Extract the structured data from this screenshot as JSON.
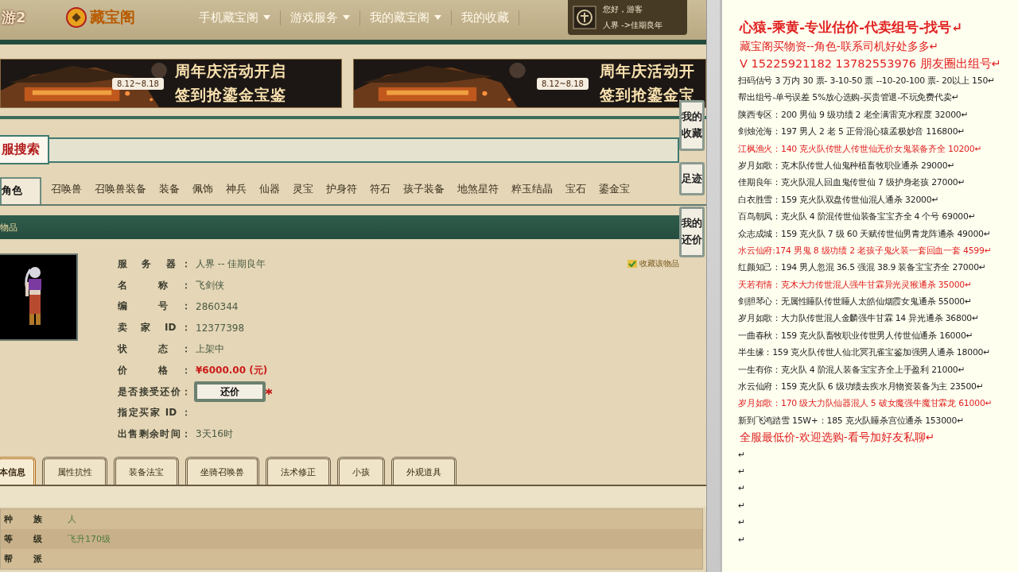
{
  "header": {
    "game_logo": "游2",
    "site_logo": "藏宝阁",
    "nav": [
      {
        "label": "手机藏宝阁",
        "dropdown": true
      },
      {
        "label": "游戏服务",
        "dropdown": true
      },
      {
        "label": "我的藏宝阁",
        "dropdown": true
      },
      {
        "label": "我的收藏",
        "dropdown": false
      }
    ],
    "user": {
      "greeting": "您好，游客",
      "server": "人界 ->佳期良年"
    }
  },
  "banners": [
    {
      "date": "8.12~8.18",
      "line_1": "周年庆活动开启",
      "line_2": "签到抢鎏金宝鉴"
    },
    {
      "date": "8.12~8.18",
      "line_1": "周年庆活动开",
      "line_2": "签到抢鎏金宝"
    }
  ],
  "search": {
    "label": "服搜索"
  },
  "categories": [
    {
      "label": "角色",
      "selected": true
    },
    {
      "label": "召唤兽",
      "selected": false
    },
    {
      "label": "召唤兽装备",
      "selected": false
    },
    {
      "label": "装备",
      "selected": false
    },
    {
      "label": "佩饰",
      "selected": false
    },
    {
      "label": "神兵",
      "selected": false
    },
    {
      "label": "仙器",
      "selected": false
    },
    {
      "label": "灵宝",
      "selected": false
    },
    {
      "label": "护身符",
      "selected": false
    },
    {
      "label": "符石",
      "selected": false
    },
    {
      "label": "孩子装备",
      "selected": false
    },
    {
      "label": "地煞星符",
      "selected": false
    },
    {
      "label": "粹玉结晶",
      "selected": false
    },
    {
      "label": "宝石",
      "selected": false
    },
    {
      "label": "鎏金宝",
      "selected": false
    }
  ],
  "section_title": "物品",
  "side_tabs": [
    "我的收藏",
    "足迹",
    "我的还价"
  ],
  "item": {
    "kind": "picture",
    "favorite_link": "收藏该物品",
    "fields": [
      {
        "label": "服 务 器：",
        "value": "人界 -- 佳期良年",
        "kind": "text"
      },
      {
        "label": "名 称：",
        "value": "飞剑侠",
        "kind": "text"
      },
      {
        "label": "编 号：",
        "value": "2860344",
        "kind": "text"
      },
      {
        "label": "卖 家 ID：",
        "value": "12377398",
        "kind": "text"
      },
      {
        "label": "状 态：",
        "value": "上架中",
        "kind": "text"
      },
      {
        "label": "价 格：",
        "value": "¥6000.00 (元)",
        "kind": "price"
      },
      {
        "label": "是否接受还价：",
        "value": "还价",
        "kind": "button"
      },
      {
        "label": "指定买家 ID ：",
        "kind": "text"
      },
      {
        "label": "出售剩余时间：",
        "value": "3天16时",
        "kind": "text"
      }
    ]
  },
  "detail_tabs": [
    {
      "label": "本信息",
      "selected": true
    },
    {
      "label": "属性抗性",
      "selected": false
    },
    {
      "label": "装备法宝",
      "selected": false
    },
    {
      "label": "坐骑召唤兽",
      "selected": false
    },
    {
      "label": "法术修正",
      "selected": false
    },
    {
      "label": "小孩",
      "selected": false
    },
    {
      "label": "外观道具",
      "selected": false
    }
  ],
  "attributes": [
    {
      "label": "种 族",
      "value": "人"
    },
    {
      "label": "等 级",
      "value": "飞升170级"
    },
    {
      "label": "帮 派"
    }
  ],
  "notes": [
    {
      "kind": "title",
      "color": "#e02020",
      "text": "心猿-乘黄-专业估价-代卖组号-找号↵"
    },
    {
      "kind": "contact",
      "color": "#e02020",
      "text": "藏宝阁买物资--角色-联系司机好处多多↵"
    },
    {
      "kind": "phone",
      "color": "#e02020",
      "text": "V 15225921182   13782553976 朋友圈出组号↵"
    },
    {
      "kind": "line",
      "color": "#222222",
      "text": "扫码估号 3 万内 30 票- 3-10-50 票  --10-20-100 票- 20以上 150↵"
    },
    {
      "kind": "line",
      "color": "#222222",
      "text": "帮出组号-单号误差 5%放心选购-买贵管退-不玩免费代卖↵"
    },
    {
      "kind": "line",
      "color": "#222222",
      "text": "陕西专区：200 男仙 9 级功绩 2 老全满雷克水程度 32000↵"
    },
    {
      "kind": "line",
      "color": "#222222",
      "text": "剑烛沧海：197 男人 2 老 5 正骨混心猿孟极妙音 116800↵"
    },
    {
      "kind": "line",
      "color": "#e02020",
      "text": "江枫渔火：140 克火队传世人传世仙无价女鬼装备齐全 10200↵"
    },
    {
      "kind": "line",
      "color": "#222222",
      "text": "岁月如歌：克木队传世人仙鬼种植畜牧职业通杀 29000↵"
    },
    {
      "kind": "line",
      "color": "#222222",
      "text": "佳期良年：克火队混人回血鬼传世仙 7 级护身老孩 27000↵"
    },
    {
      "kind": "line",
      "color": "#222222",
      "text": "白衣胜雪：159 克火队双盘传世仙混人通杀 32000↵"
    },
    {
      "kind": "line",
      "color": "#222222",
      "text": "百鸟朝凤：克火队 4 阶混传世仙装备宝宝齐全 4 个号 69000↵"
    },
    {
      "kind": "line",
      "color": "#222222",
      "text": "众志成城：159 克火队 7 级 60 天赋传世仙男青龙阵通杀 49000↵"
    },
    {
      "kind": "line",
      "color": "#e02020",
      "text": "水云仙府:174 男鬼 8 级功绩 2 老孩子鬼火装一套回血一套 4599↵"
    },
    {
      "kind": "line",
      "color": "#222222",
      "text": "红颜知己：194 男人忽混 36.5 强混 38.9 装备宝宝齐全 27000↵"
    },
    {
      "kind": "line",
      "color": "#e02020",
      "text": "天若有情：克木大力传世混人强牛甘霖异光灵猴通杀 35000↵"
    },
    {
      "kind": "line",
      "color": "#222222",
      "text": "剑胆琴心：无属性睡队传世睡人太皓仙烟霞女鬼通杀 55000↵"
    },
    {
      "kind": "line",
      "color": "#222222",
      "text": "岁月如歌：大力队传世混人金麟强牛甘霖 14 异光通杀 36800↵"
    },
    {
      "kind": "line",
      "color": "#222222",
      "text": "一曲春秋：159 克火队畜牧职业传世男人传世仙通杀 16000↵"
    },
    {
      "kind": "line",
      "color": "#222222",
      "text": "半生缘：159 克火队传世人仙北冥孔雀宝鉴加强男人通杀 18000↵"
    },
    {
      "kind": "line",
      "color": "#222222",
      "text": "一生有你：克火队 4 阶混人装备宝宝齐全上手盈利 21000↵"
    },
    {
      "kind": "line",
      "color": "#222222",
      "text": "水云仙府：159 克火队 6 级功绩去疾水月物资装备为主 23500↵"
    },
    {
      "kind": "line",
      "color": "#e02020",
      "text": "岁月如歌：170 级大力队仙器混人 5 破女魔强牛魔甘霖龙 61000↵"
    },
    {
      "kind": "line",
      "color": "#222222",
      "text": "新到飞鸿踏雪 15W+：185 克火队睡杀宫位通杀 153000↵"
    },
    {
      "kind": "contact",
      "color": "#e02020",
      "text": "全服最低价-欢迎选购-看号加好友私聊↵"
    },
    {
      "kind": "line",
      "color": "#222222",
      "text": "↵"
    },
    {
      "kind": "line",
      "color": "#222222",
      "text": "↵"
    },
    {
      "kind": "line",
      "color": "#222222",
      "text": "↵"
    },
    {
      "kind": "line",
      "color": "#222222",
      "text": "↵"
    },
    {
      "kind": "line",
      "color": "#222222",
      "text": "↵"
    },
    {
      "kind": "line",
      "color": "#222222",
      "text": "↵"
    }
  ]
}
